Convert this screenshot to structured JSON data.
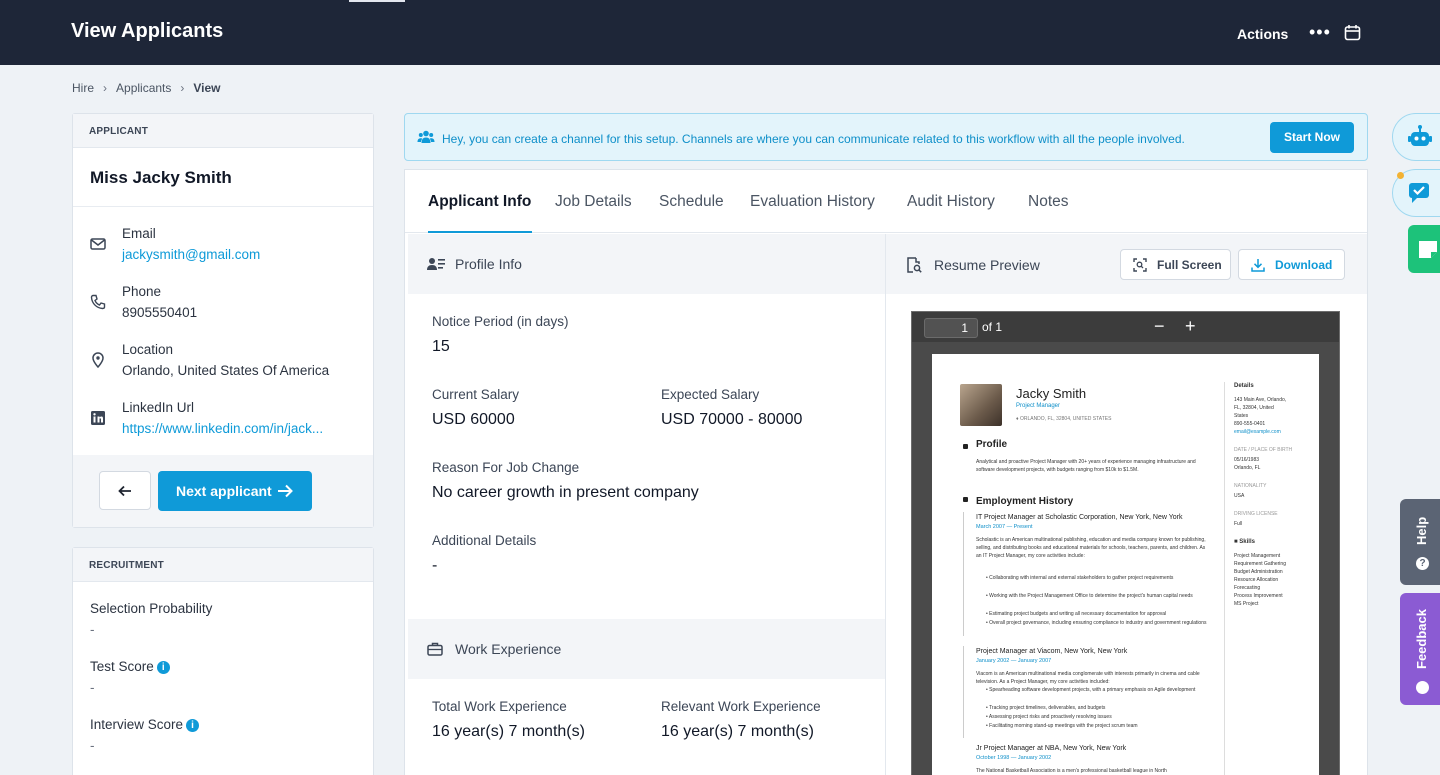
{
  "header": {
    "title": "View Applicants",
    "actions_label": "Actions"
  },
  "breadcrumb": [
    "Hire",
    "Applicants",
    "View"
  ],
  "applicant": {
    "section_label": "APPLICANT",
    "name": "Miss Jacky Smith",
    "email_label": "Email",
    "email": "jackysmith@gmail.com",
    "phone_label": "Phone",
    "phone": "8905550401",
    "location_label": "Location",
    "location": "Orlando, United States Of America",
    "linkedin_label": "LinkedIn Url",
    "linkedin": "https://www.linkedin.com/in/jack...",
    "next_label": "Next applicant"
  },
  "recruitment": {
    "section_label": "RECRUITMENT",
    "rows": [
      {
        "label": "Selection Probability",
        "value": "-"
      },
      {
        "label": "Test Score",
        "value": "-"
      },
      {
        "label": "Interview Score",
        "value": "-"
      }
    ]
  },
  "banner": {
    "text": "Hey, you can create a channel for this setup. Channels are where you can communicate related to this workflow with all the people involved.",
    "button": "Start Now"
  },
  "tabs": [
    "Applicant Info",
    "Job Details",
    "Schedule",
    "Evaluation History",
    "Audit History",
    "Notes"
  ],
  "profile": {
    "section_label": "Profile Info",
    "notice_label": "Notice Period (in days)",
    "notice_value": "15",
    "current_salary_label": "Current Salary",
    "current_salary": "USD 60000",
    "expected_salary_label": "Expected Salary",
    "expected_salary": "USD 70000 - 80000",
    "reason_label": "Reason For Job Change",
    "reason_value": "No career growth in present company",
    "additional_label": "Additional Details",
    "additional_value": "-"
  },
  "work": {
    "section_label": "Work Experience",
    "total_label": "Total Work Experience",
    "total_value": "16 year(s) 7 month(s)",
    "relevant_label": "Relevant Work Experience",
    "relevant_value": "16 year(s) 7 month(s)"
  },
  "resume": {
    "section_label": "Resume Preview",
    "fullscreen": "Full Screen",
    "download": "Download",
    "page_input": "1",
    "page_of": "of 1",
    "doc": {
      "name": "Jacky Smith",
      "role": "Project Manager",
      "location": "ORLANDO, FL, 32804, UNITED STATES",
      "profile_heading": "Profile",
      "profile_text": "Analytical and proactive Project Manager with 20+ years of experience managing infrastructure and software development projects, with budgets ranging from $10k to $1.5M.",
      "employment_heading": "Employment History",
      "job1_title": "IT Project Manager at Scholastic Corporation, New York, New York",
      "job1_dates": "March 2007 — Present",
      "job1_text": "Scholastic is an American multinational publishing, education and media company known for publishing, selling, and distributing books and educational materials for schools, teachers, parents, and children. As an IT Project Manager, my core activities include:",
      "job1_items": [
        "Collaborating with internal and external stakeholders to gather project requirements",
        "Working with the Project Management Office to determine the project's human capital needs",
        "Estimating project budgets and writing all necessary documentation for approval",
        "Overall project governance, including ensuring compliance to industry and government regulations"
      ],
      "job2_title": "Project Manager at Viacom, New York, New York",
      "job2_dates": "January 2002 — January 2007",
      "job2_text": "Viacom is an American multinational media conglomerate with interests primarily in cinema and cable television. As a Project Manager, my core activities included:",
      "job2_items": [
        "Spearheading software development projects, with a primary emphasis on Agile development",
        "Tracking project timelines, deliverables, and budgets",
        "Assessing project risks and proactively resolving issues",
        "Facilitating morning stand-up meetings with the project scrum team"
      ],
      "job3_title": "Jr Project Manager at NBA, New York, New York",
      "job3_dates": "October 1998 — January 2002",
      "job3_text": "The National Basketball Association is a men's professional basketball league in North",
      "details_heading": "Details",
      "details_address": [
        "143 Main Ave, Orlando,",
        "FL, 32804, United",
        "States"
      ],
      "details_phone": "890-555-0401",
      "details_email": "email@example.com",
      "dob_label": "DATE / PLACE OF BIRTH",
      "dob_value": [
        "05/16/1983",
        "Orlando, FL"
      ],
      "nationality_label": "NATIONALITY",
      "nationality_value": "USA",
      "license_label": "DRIVING LICENSE",
      "license_value": "Full",
      "skills_heading": "Skills",
      "skills": [
        "Project Management",
        "Requirement Gathering",
        "Budget Administration",
        "Resource Allocation",
        "Forecasting",
        "Process Improvement",
        "MS Project"
      ]
    }
  },
  "side_tabs": {
    "help": "Help",
    "feedback": "Feedback"
  },
  "colors": {
    "header_bg": "#1e2638",
    "accent": "#0f9ad8",
    "feedback": "#8b5bd3",
    "note_green": "#1dc27a"
  }
}
